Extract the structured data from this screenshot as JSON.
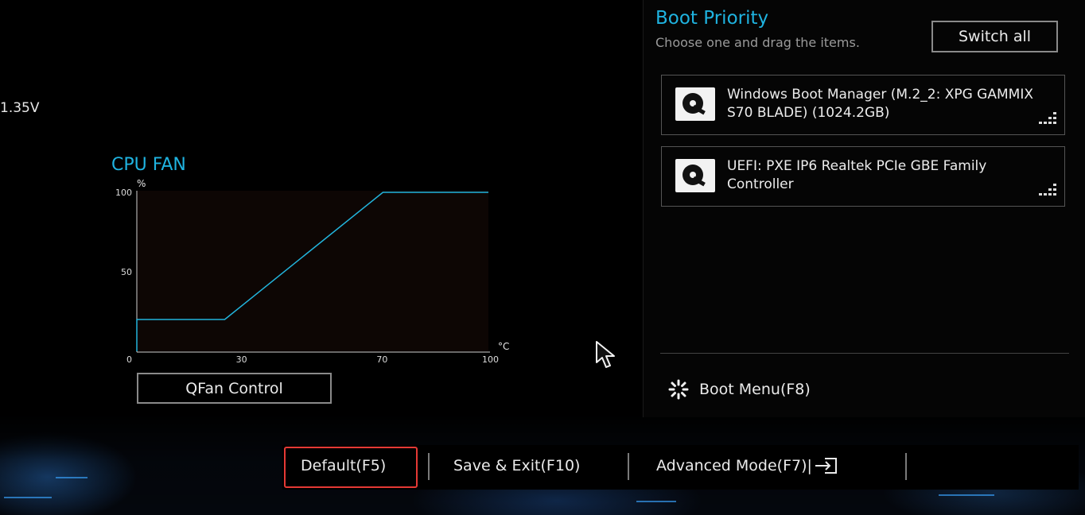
{
  "left_panel": {
    "voltage_text": "1.35V"
  },
  "cpu_fan": {
    "title": "CPU FAN",
    "qfan_button": "QFan Control"
  },
  "chart_data": {
    "type": "line",
    "title": "CPU FAN",
    "xlabel": "°C",
    "ylabel": "%",
    "x_ticks": [
      "0",
      "30",
      "70",
      "100"
    ],
    "y_ticks": [
      "100",
      "50",
      "0"
    ],
    "xlim": [
      0,
      100
    ],
    "ylim": [
      0,
      100
    ],
    "grid": false,
    "series": [
      {
        "x": [
          0,
          0,
          25,
          70,
          100
        ],
        "y": [
          0,
          20,
          20,
          100,
          100
        ]
      }
    ],
    "line_color": "#22b4dc",
    "plot_bg": "#0d0604"
  },
  "boot_priority": {
    "title": "Boot Priority",
    "subtitle": "Choose one and drag the items.",
    "switch_all": "Switch all",
    "items": [
      {
        "label": "Windows Boot Manager (M.2_2: XPG GAMMIX S70 BLADE) (1024.2GB)",
        "icon": "disk-icon"
      },
      {
        "label": "UEFI: PXE IP6 Realtek PCIe GBE Family Controller",
        "icon": "disk-icon"
      }
    ],
    "boot_menu": "Boot Menu(F8)"
  },
  "footer": {
    "default": "Default(F5)",
    "save_exit": "Save & Exit(F10)",
    "advanced_mode": "Advanced Mode(F7)|"
  },
  "colors": {
    "accent": "#1fb3e0",
    "highlight": "#e53935"
  }
}
